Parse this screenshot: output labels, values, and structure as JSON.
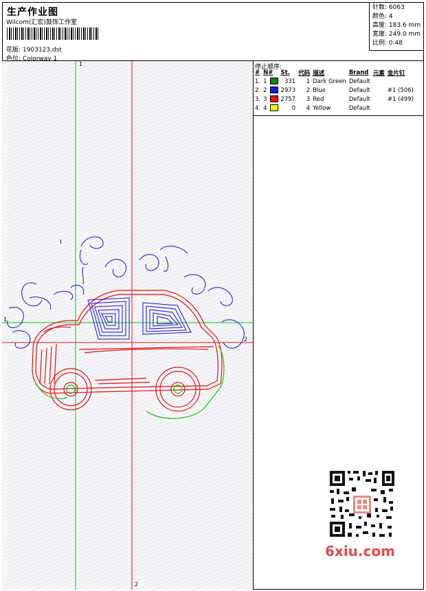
{
  "header": {
    "title": "生产作业图",
    "studio": "Wilcom(汇宏)鼓饰工作室",
    "design_label": "花版:",
    "design_file": "1903123.dst",
    "color_label": "色位:",
    "colorway": "Colorway 1"
  },
  "stats": {
    "stitches_label": "针数:",
    "stitches": "6063",
    "colors_label": "颜色:",
    "colors": "4",
    "height_label": "高度:",
    "height": "183.6 mm",
    "width_label": "宽度:",
    "width": "249.0 mm",
    "scale_label": "比例:",
    "scale": "0.48"
  },
  "stop_sequence": {
    "title": "停止顺序:",
    "headers": [
      "#",
      "N#",
      "St.",
      "代码",
      "描述",
      "Brand",
      "元素",
      "金片钉"
    ],
    "rows": [
      {
        "idx": "1.",
        "n": "1",
        "color": "#0b8a12",
        "st": "331",
        "code": "1",
        "desc": "Dark Green",
        "brand": "Default",
        "elem": "",
        "seq": ""
      },
      {
        "idx": "2.",
        "n": "2",
        "color": "#1515e6",
        "st": "2973",
        "code": "2",
        "desc": "Blue",
        "brand": "Default",
        "elem": "",
        "seq": "#1 (506)"
      },
      {
        "idx": "3.",
        "n": "3",
        "color": "#e61515",
        "st": "2757",
        "code": "3",
        "desc": "Red",
        "brand": "Default",
        "elem": "",
        "seq": "#1 (499)"
      },
      {
        "idx": "4.",
        "n": "4",
        "color": "#f5f500",
        "st": "0",
        "code": "4",
        "desc": "Yellow",
        "brand": "Default",
        "elem": "",
        "seq": ""
      }
    ]
  },
  "axes": {
    "v1": "1",
    "v2": "2",
    "h1": "1",
    "h2": "2"
  },
  "watermark": "6xiu.com",
  "colors": {
    "green": "#11c011",
    "red": "#e01010",
    "blue": "#1010d0"
  }
}
